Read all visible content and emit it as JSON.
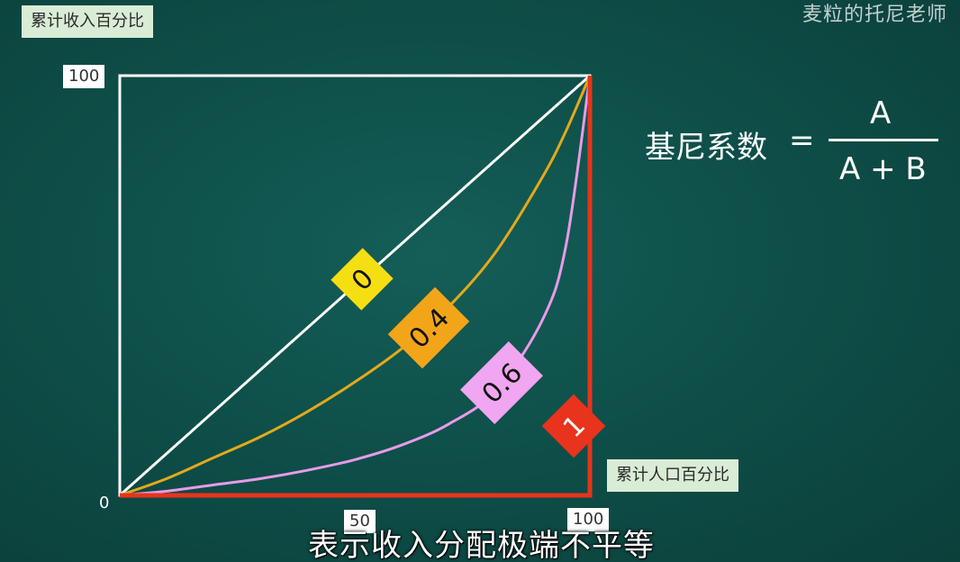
{
  "header": {
    "watermark": "麦粒的托尼老师"
  },
  "formula": {
    "lhs": "基尼系数",
    "equals": "=",
    "numerator": "A",
    "denominator": "A + B"
  },
  "subtitle": "表示收入分配极端不平等",
  "chart_data": {
    "type": "line",
    "ylabel": "累计收入百分比",
    "xlabel": "累计人口百分比",
    "xlim": [
      0,
      100
    ],
    "ylim": [
      0,
      100
    ],
    "x_ticks": [
      "50",
      "100"
    ],
    "y_ticks": [
      "100"
    ],
    "origin_label": "0",
    "grid": false,
    "series": [
      {
        "name": "0",
        "color": "#ffffff",
        "gini": 0,
        "x": [
          0,
          100
        ],
        "y": [
          0,
          100
        ]
      },
      {
        "name": "0.4",
        "color": "#e3a91c",
        "gini": 0.4,
        "x": [
          0,
          10,
          20,
          30,
          40,
          50,
          60,
          70,
          80,
          90,
          95,
          100
        ],
        "y": [
          0,
          4,
          9,
          14,
          20,
          27,
          35,
          45,
          58,
          76,
          87,
          100
        ]
      },
      {
        "name": "0.6",
        "color": "#e79be8",
        "gini": 0.6,
        "x": [
          0,
          10,
          20,
          30,
          40,
          50,
          60,
          70,
          80,
          90,
          95,
          100
        ],
        "y": [
          0,
          1,
          2.5,
          4,
          6,
          8.5,
          12,
          17,
          25,
          42,
          60,
          100
        ]
      },
      {
        "name": "1",
        "color": "#e8341c",
        "gini": 1,
        "x": [
          0,
          100,
          100
        ],
        "y": [
          0,
          0,
          100
        ]
      }
    ]
  }
}
